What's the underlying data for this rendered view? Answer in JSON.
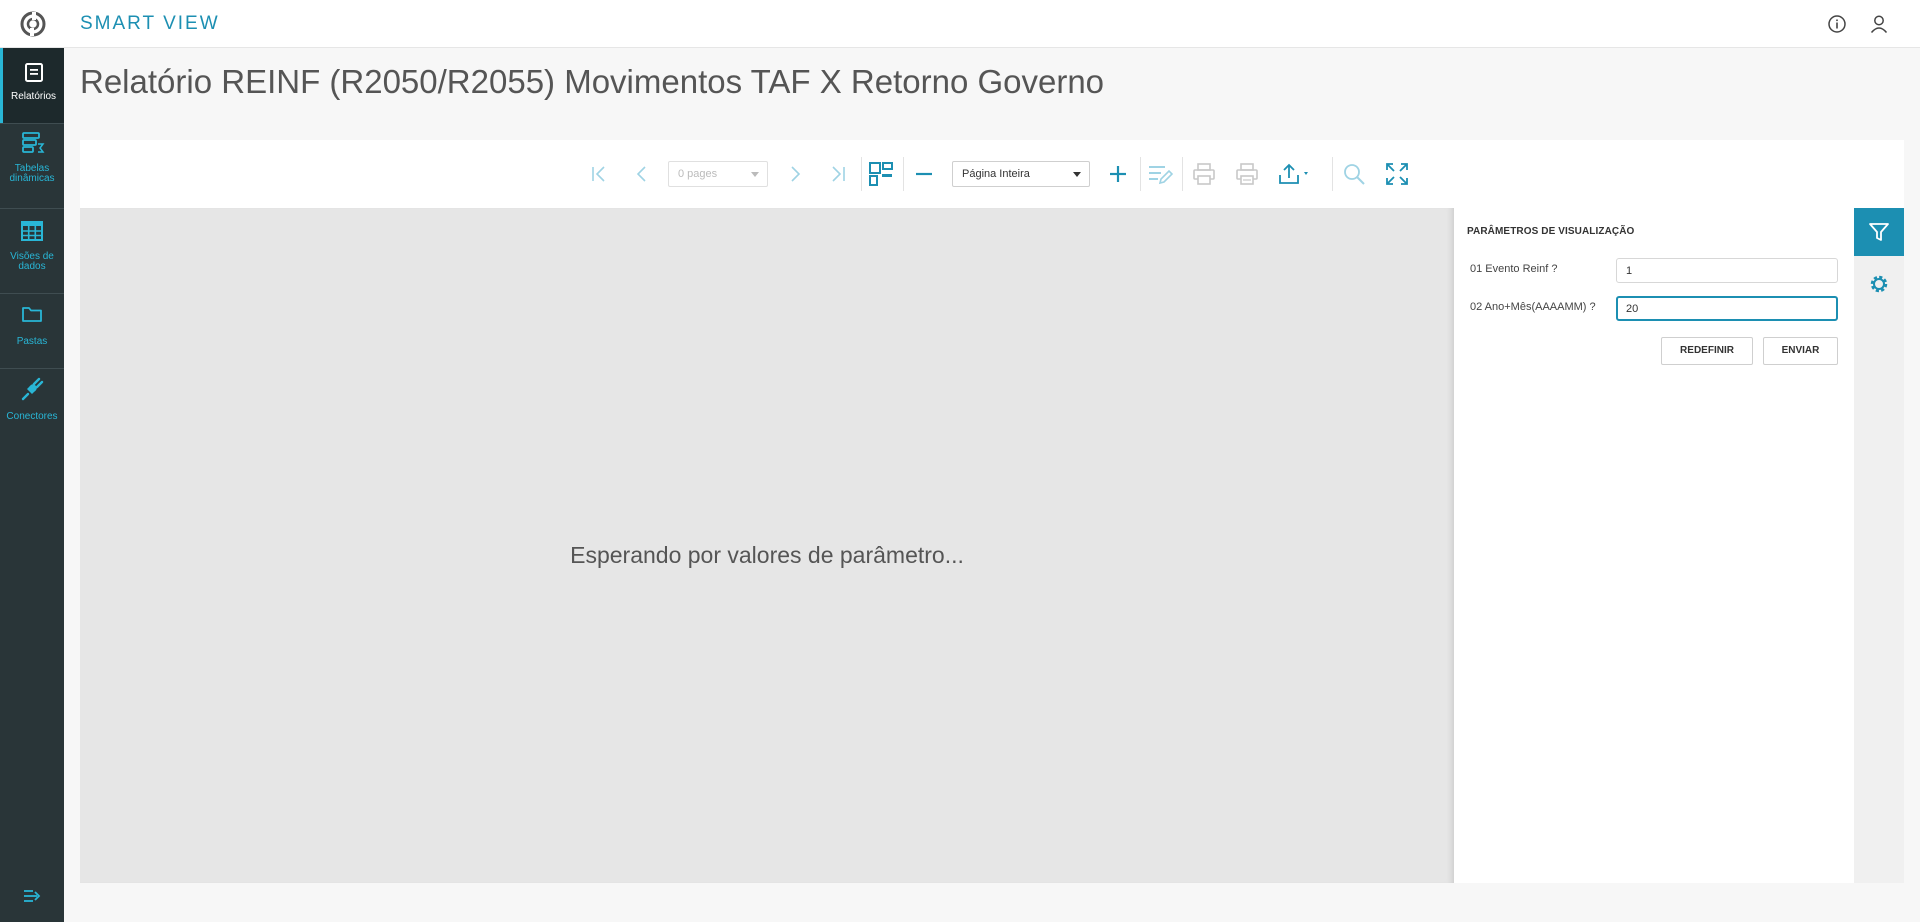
{
  "header": {
    "brand": "SMART VIEW",
    "icons": [
      "logo-icon",
      "info-icon",
      "user-icon"
    ]
  },
  "sidebar": {
    "items": [
      {
        "label": "Relatórios",
        "icon": "report-icon",
        "active": true
      },
      {
        "label": "Tabelas dinâmicas",
        "icon": "pivot-table-icon",
        "active": false
      },
      {
        "label": "Visões de dados",
        "icon": "data-grid-icon",
        "active": false
      },
      {
        "label": "Pastas",
        "icon": "folder-icon",
        "active": false
      },
      {
        "label": "Conectores",
        "icon": "plug-icon",
        "active": false
      }
    ],
    "collapse_icon": "collapse-menu-icon"
  },
  "page": {
    "title": "Relatório REINF (R2050/R2055) Movimentos TAF X Retorno Governo"
  },
  "toolbar": {
    "pages_value": "0 pages",
    "zoom_value": "Página Inteira",
    "icons": [
      "first-page-icon",
      "prev-page-icon",
      "next-page-icon",
      "last-page-icon",
      "multipage-icon",
      "zoom-out-icon",
      "zoom-in-icon",
      "edit-design-icon",
      "print-icon",
      "print-pdf-icon",
      "export-icon",
      "search-icon",
      "fullscreen-icon"
    ]
  },
  "canvas": {
    "message": "Esperando por valores de parâmetro..."
  },
  "params": {
    "title": "PARÂMETROS DE VISUALIZAÇÃO",
    "fields": [
      {
        "label": "01 Evento Reinf ?",
        "value": "1"
      },
      {
        "label": "02 Ano+Mês(AAAAMM) ?",
        "value": "20"
      }
    ],
    "reset_label": "REDEFINIR",
    "submit_label": "ENVIAR"
  },
  "colors": {
    "accent": "#1c8fb2",
    "sidebar": "#293538",
    "sidebar_label": "#29b6d6"
  }
}
